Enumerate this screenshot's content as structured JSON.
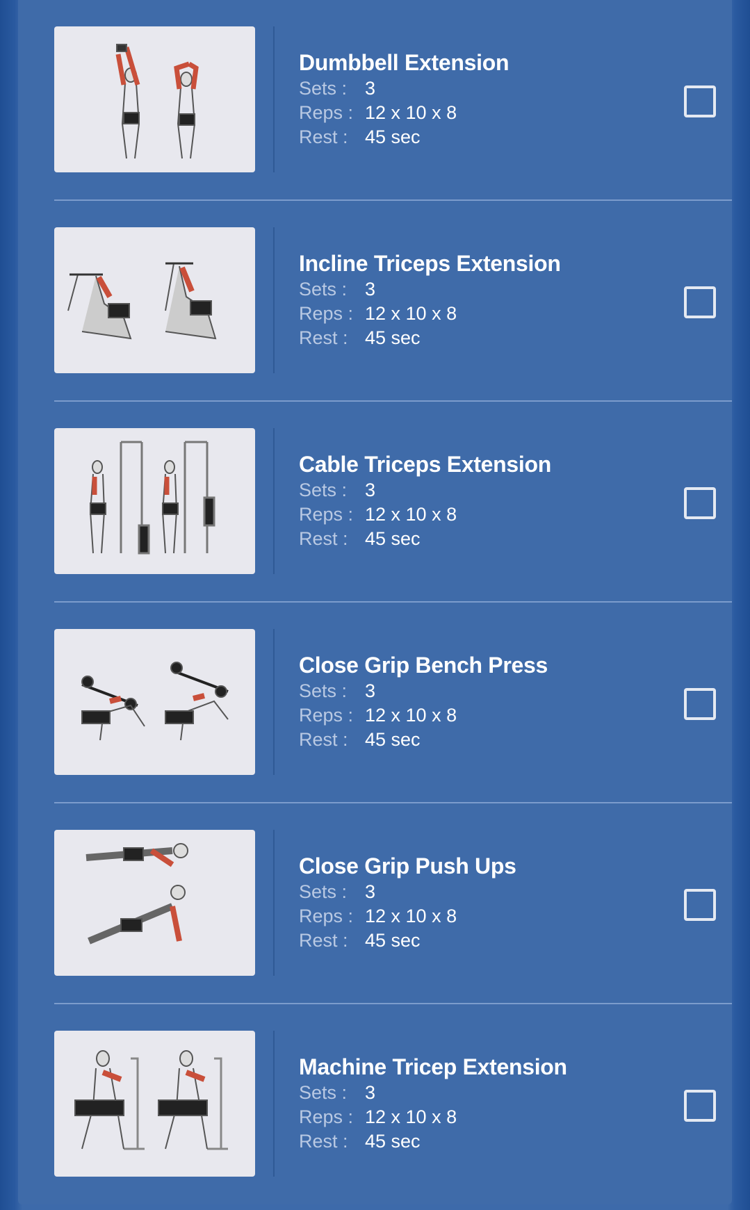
{
  "labels": {
    "sets": "Sets :",
    "reps": "Reps :",
    "rest": "Rest :"
  },
  "colors": {
    "background": "#3f6ba9",
    "edge": "#1f4e93",
    "thumb_bg": "#e8e8ee",
    "muscle_highlight": "#c94f3a"
  },
  "exercises": [
    {
      "name": "Dumbbell Extension",
      "sets": "3",
      "reps": "12 x 10 x 8",
      "rest": "45 sec",
      "checked": false,
      "image_icon": "dumbbell-extension-illustration"
    },
    {
      "name": "Incline Triceps Extension",
      "sets": "3",
      "reps": "12 x 10 x 8",
      "rest": "45 sec",
      "checked": false,
      "image_icon": "incline-triceps-extension-illustration"
    },
    {
      "name": "Cable Triceps Extension",
      "sets": "3",
      "reps": "12 x 10 x 8",
      "rest": "45 sec",
      "checked": false,
      "image_icon": "cable-triceps-extension-illustration"
    },
    {
      "name": "Close Grip Bench Press",
      "sets": "3",
      "reps": "12 x 10 x 8",
      "rest": "45 sec",
      "checked": false,
      "image_icon": "close-grip-bench-press-illustration"
    },
    {
      "name": "Close Grip Push Ups",
      "sets": "3",
      "reps": "12 x 10 x 8",
      "rest": "45 sec",
      "checked": false,
      "image_icon": "close-grip-push-ups-illustration"
    },
    {
      "name": "Machine Tricep Extension",
      "sets": "3",
      "reps": "12 x 10 x 8",
      "rest": "45 sec",
      "checked": false,
      "image_icon": "machine-tricep-extension-illustration"
    }
  ]
}
